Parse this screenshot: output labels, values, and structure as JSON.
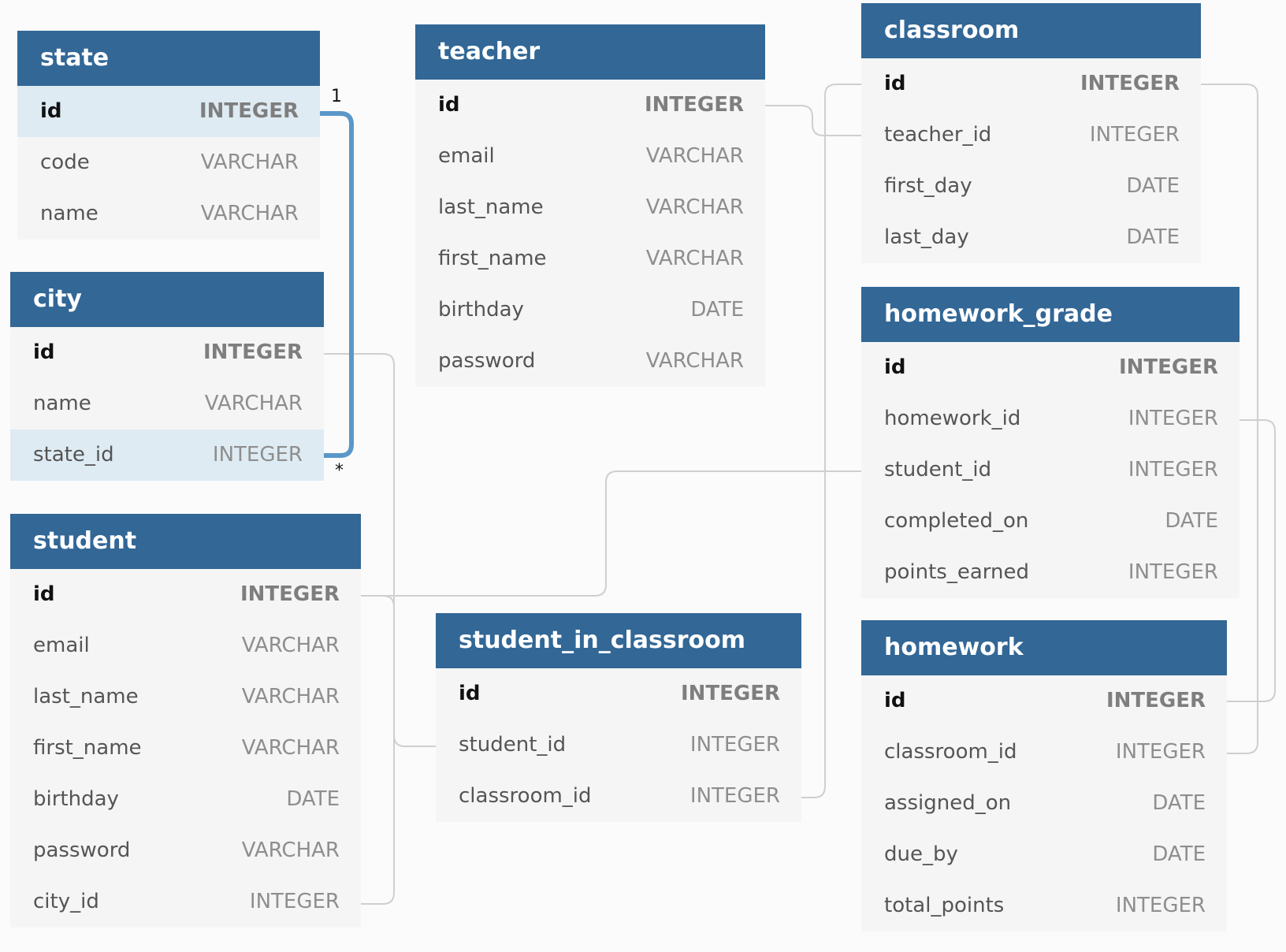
{
  "colors": {
    "header": "#326796",
    "body": "#f5f5f5",
    "highlight_row": "#deebf3",
    "relation_highlight": "#5b97c8",
    "relation": "#cfcfcf"
  },
  "tables": [
    {
      "key": "state",
      "name": "state",
      "columns": [
        {
          "name": "id",
          "type": "INTEGER",
          "pk": true,
          "highlight": true
        },
        {
          "name": "code",
          "type": "VARCHAR"
        },
        {
          "name": "name",
          "type": "VARCHAR"
        }
      ]
    },
    {
      "key": "city",
      "name": "city",
      "columns": [
        {
          "name": "id",
          "type": "INTEGER",
          "pk": true
        },
        {
          "name": "name",
          "type": "VARCHAR"
        },
        {
          "name": "state_id",
          "type": "INTEGER",
          "highlight": true
        }
      ]
    },
    {
      "key": "student",
      "name": "student",
      "columns": [
        {
          "name": "id",
          "type": "INTEGER",
          "pk": true
        },
        {
          "name": "email",
          "type": "VARCHAR"
        },
        {
          "name": "last_name",
          "type": "VARCHAR"
        },
        {
          "name": "first_name",
          "type": "VARCHAR"
        },
        {
          "name": "birthday",
          "type": "DATE"
        },
        {
          "name": "password",
          "type": "VARCHAR"
        },
        {
          "name": "city_id",
          "type": "INTEGER"
        }
      ]
    },
    {
      "key": "teacher",
      "name": "teacher",
      "columns": [
        {
          "name": "id",
          "type": "INTEGER",
          "pk": true
        },
        {
          "name": "email",
          "type": "VARCHAR"
        },
        {
          "name": "last_name",
          "type": "VARCHAR"
        },
        {
          "name": "first_name",
          "type": "VARCHAR"
        },
        {
          "name": "birthday",
          "type": "DATE"
        },
        {
          "name": "password",
          "type": "VARCHAR"
        }
      ]
    },
    {
      "key": "student_in_classroom",
      "name": "student_in_classroom",
      "columns": [
        {
          "name": "id",
          "type": "INTEGER",
          "pk": true
        },
        {
          "name": "student_id",
          "type": "INTEGER"
        },
        {
          "name": "classroom_id",
          "type": "INTEGER"
        }
      ]
    },
    {
      "key": "classroom",
      "name": "classroom",
      "columns": [
        {
          "name": "id",
          "type": "INTEGER",
          "pk": true
        },
        {
          "name": "teacher_id",
          "type": "INTEGER"
        },
        {
          "name": "first_day",
          "type": "DATE"
        },
        {
          "name": "last_day",
          "type": "DATE"
        }
      ]
    },
    {
      "key": "homework_grade",
      "name": "homework_grade",
      "columns": [
        {
          "name": "id",
          "type": "INTEGER",
          "pk": true
        },
        {
          "name": "homework_id",
          "type": "INTEGER"
        },
        {
          "name": "student_id",
          "type": "INTEGER"
        },
        {
          "name": "completed_on",
          "type": "DATE"
        },
        {
          "name": "points_earned",
          "type": "INTEGER"
        }
      ]
    },
    {
      "key": "homework",
      "name": "homework",
      "columns": [
        {
          "name": "id",
          "type": "INTEGER",
          "pk": true
        },
        {
          "name": "classroom_id",
          "type": "INTEGER"
        },
        {
          "name": "assigned_on",
          "type": "DATE"
        },
        {
          "name": "due_by",
          "type": "DATE"
        },
        {
          "name": "total_points",
          "type": "INTEGER"
        }
      ]
    }
  ],
  "relations": [
    {
      "from": "city.state_id",
      "to": "state.id",
      "highlighted": true,
      "cardinality_one": "1",
      "cardinality_many": "*"
    },
    {
      "from": "student.city_id",
      "to": "city.id"
    },
    {
      "from": "student_in_classroom.student_id",
      "to": "student.id"
    },
    {
      "from": "homework_grade.student_id",
      "to": "student.id"
    },
    {
      "from": "classroom.teacher_id",
      "to": "teacher.id"
    },
    {
      "from": "student_in_classroom.classroom_id",
      "to": "classroom.id"
    },
    {
      "from": "homework_grade.homework_id",
      "to": "homework.id"
    },
    {
      "from": "homework.classroom_id",
      "to": "classroom.id"
    }
  ]
}
